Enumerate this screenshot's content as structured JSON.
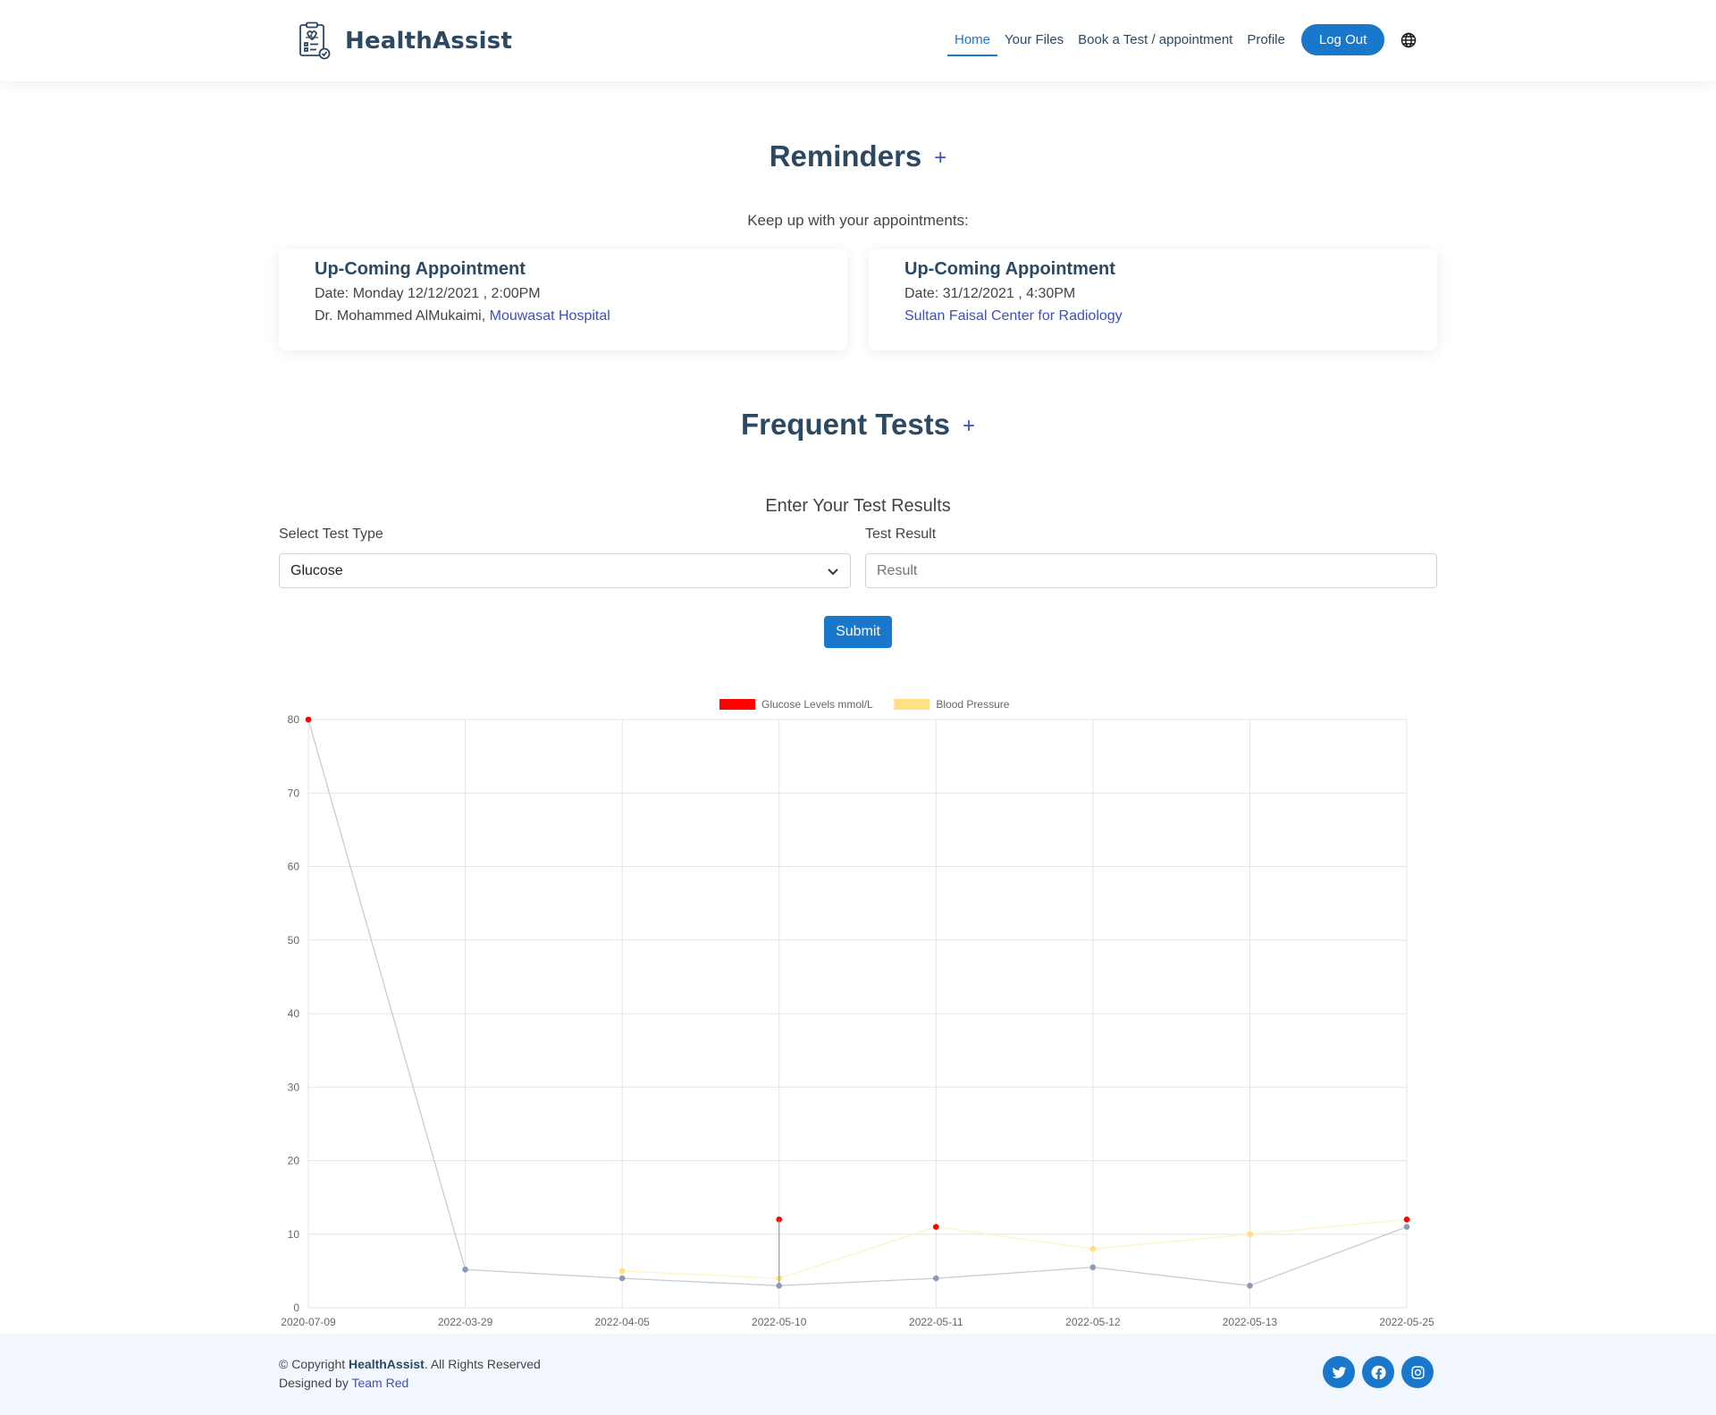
{
  "brand": {
    "name": "HealthAssist"
  },
  "nav": {
    "items": [
      {
        "label": "Home",
        "active": true
      },
      {
        "label": "Your Files"
      },
      {
        "label": "Book a Test / appointment"
      },
      {
        "label": "Profile"
      }
    ],
    "logout_label": "Log Out",
    "language_icon": "globe-icon"
  },
  "reminders": {
    "title": "Reminders",
    "add_symbol": "+",
    "subtitle": "Keep up with your appointments:",
    "cards": [
      {
        "title": "Up-Coming Appointment",
        "date": "Date: Monday 12/12/2021 , 2:00PM",
        "doctor": "Dr. Mohammed AlMukaimi,",
        "place": "Mouwasat Hospital"
      },
      {
        "title": "Up-Coming Appointment",
        "date": "Date: 31/12/2021 , 4:30PM",
        "place": "Sultan Faisal Center for Radiology"
      }
    ]
  },
  "tests": {
    "title": "Frequent Tests",
    "add_symbol": "+",
    "form_heading": "Enter Your Test Results",
    "type_label": "Select Test Type",
    "type_value": "Glucose",
    "result_label": "Test Result",
    "result_placeholder": "Result",
    "submit_label": "Submit"
  },
  "chart_data": {
    "type": "line",
    "title": "",
    "xlabel": "",
    "ylabel": "",
    "categories": [
      "2020-07-09",
      "2022-03-29",
      "2022-04-05",
      "2022-05-10",
      "2022-05-11",
      "2022-05-12",
      "2022-05-13",
      "2022-05-25"
    ],
    "ylim": [
      0,
      80
    ],
    "yticks": [
      0,
      10,
      20,
      30,
      40,
      50,
      60,
      70,
      80
    ],
    "grid": true,
    "legend": "top-center",
    "series": [
      {
        "name": "Glucose Levels mmol/L",
        "color": "#ff0000",
        "line_color": "#c9cbcf",
        "values": [
          80,
          5.2,
          4,
          3,
          4,
          5.5,
          3,
          11
        ]
      },
      {
        "name": "Blood Pressure",
        "color": "#ffe082",
        "line_color": "#fff3c4",
        "values": [
          null,
          null,
          5,
          4,
          11,
          8,
          10,
          12
        ]
      }
    ],
    "extra_points": [
      {
        "x": "2022-05-10",
        "y": 12,
        "series": "Glucose Levels mmol/L"
      },
      {
        "x": "2022-05-11",
        "y": 11,
        "series": "Glucose Levels mmol/L"
      },
      {
        "x": "2022-05-25",
        "y": 12,
        "series": "Glucose Levels mmol/L"
      }
    ]
  },
  "footer": {
    "copyright_prefix": "© Copyright",
    "brand": "HealthAssist",
    "copyright_suffix": ". All Rights Reserved",
    "designed_by": "Designed by",
    "team": "Team Red",
    "social": [
      "twitter-icon",
      "facebook-icon",
      "instagram-icon"
    ]
  }
}
